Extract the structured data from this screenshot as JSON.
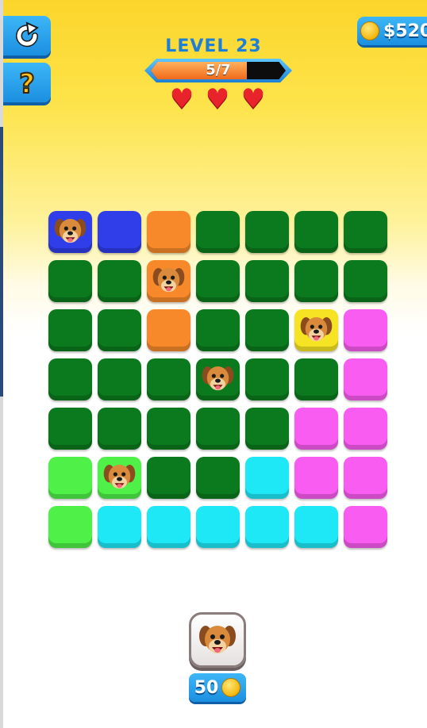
{
  "hud": {
    "coins_text": "$520",
    "level_title": "LEVEL 23",
    "progress_text": "5/7",
    "progress_fraction": 0.714,
    "lives": 3
  },
  "buttons": {
    "restart_icon": "restart-arrow-icon",
    "help_icon": "question-mark-icon",
    "pet_powerup_cost": "50"
  },
  "colors": {
    "blue": "#2f3ee8",
    "orange": "#f7892a",
    "darkgreen": "#0b7a1e",
    "yellow": "#f6e424",
    "pink": "#f95cf0",
    "lime": "#4ff048",
    "cyan": "#1ee8f6",
    "heart": "#e8232b"
  },
  "board": {
    "rows": 7,
    "cols": 7,
    "tiles": [
      [
        "blue:dog",
        "blue",
        "orange",
        "darkgreen",
        "darkgreen",
        "darkgreen",
        "darkgreen"
      ],
      [
        "darkgreen",
        "darkgreen",
        "orange:dog",
        "darkgreen",
        "darkgreen",
        "darkgreen",
        "darkgreen"
      ],
      [
        "darkgreen",
        "darkgreen",
        "orange",
        "darkgreen",
        "darkgreen",
        "yellow:dog",
        "pink"
      ],
      [
        "darkgreen",
        "darkgreen",
        "darkgreen",
        "darkgreen:dog",
        "darkgreen",
        "darkgreen",
        "pink"
      ],
      [
        "darkgreen",
        "darkgreen",
        "darkgreen",
        "darkgreen",
        "darkgreen",
        "pink",
        "pink"
      ],
      [
        "lime",
        "lime:dog",
        "darkgreen",
        "darkgreen",
        "cyan",
        "pink",
        "pink"
      ],
      [
        "lime",
        "cyan",
        "cyan",
        "cyan",
        "cyan",
        "cyan",
        "pink"
      ]
    ]
  }
}
